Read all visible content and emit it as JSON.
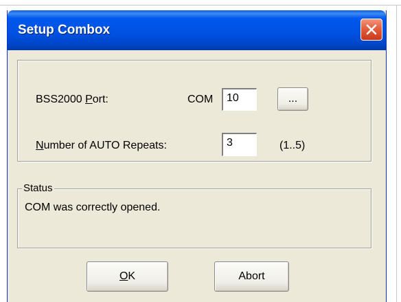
{
  "window": {
    "title": "Setup Combox"
  },
  "settings": {
    "port_label_prefix": "BSS2000 ",
    "port_label_accel": "P",
    "port_label_suffix": "ort:",
    "com_label": "COM",
    "port_value": "10",
    "browse_label": "...",
    "repeats_label_accel": "N",
    "repeats_label_rest": "umber of AUTO Repeats:",
    "repeats_value": "3",
    "repeats_range": "(1..5)"
  },
  "status": {
    "legend": "Status",
    "message": "COM was correctly opened."
  },
  "buttons": {
    "ok_accel": "O",
    "ok_rest": "K",
    "abort_label": "Abort"
  }
}
